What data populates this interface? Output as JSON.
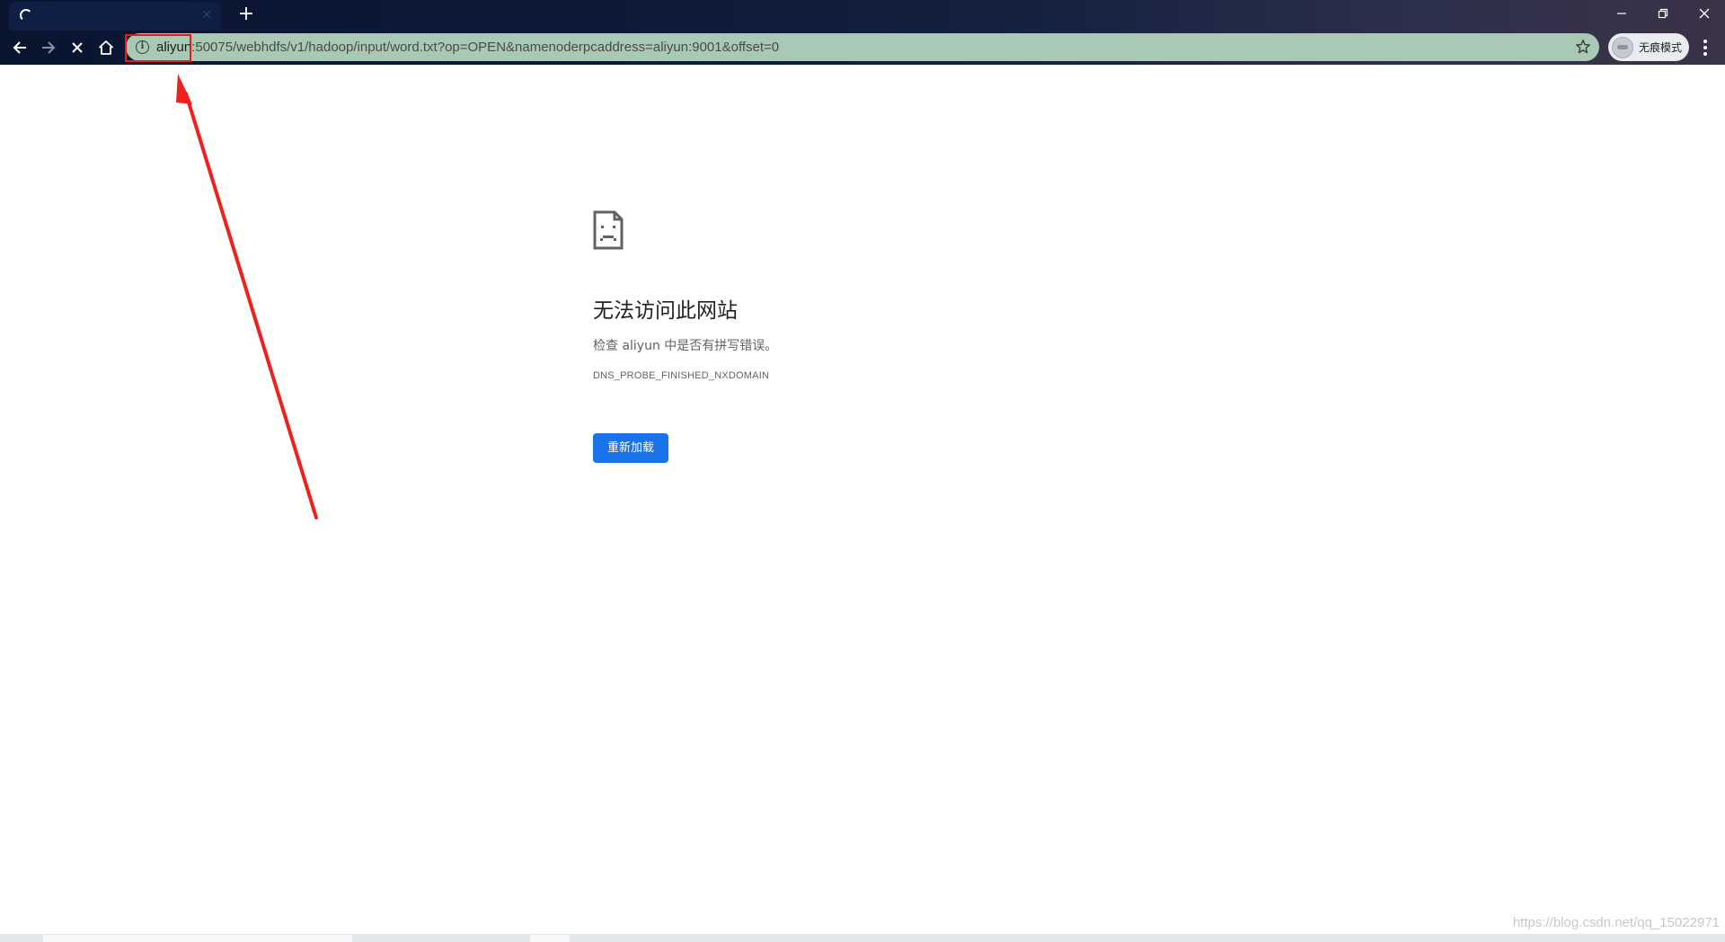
{
  "browser": {
    "new_tab_glyph": "+",
    "window_controls": {
      "minimize_icon": "minimize-icon",
      "restore_icon": "restore-icon",
      "close_icon": "close-icon"
    },
    "address_bar": {
      "host": "aliyun",
      "path": ":50075/webhdfs/v1/hadoop/input/word.txt?op=OPEN&namenoderpcaddress=aliyun:9001&offset=0",
      "security_icon": "info-icon",
      "bookmark_icon": "star-icon",
      "background_color": "#a9c9b4"
    },
    "profile_chip": {
      "label": "无痕模式"
    }
  },
  "error_page": {
    "icon": "sad-page-icon",
    "title": "无法访问此网站",
    "detail": "检查 aliyun 中是否有拼写错误。",
    "error_code": "DNS_PROBE_FINISHED_NXDOMAIN",
    "reload_button_label": "重新加载",
    "button_color": "#1a73e8"
  },
  "annotation": {
    "color": "#e81a1a",
    "highlight": "aliyun host in address bar"
  },
  "footer": {
    "watermark": "https://blog.csdn.net/qq_15022971"
  }
}
